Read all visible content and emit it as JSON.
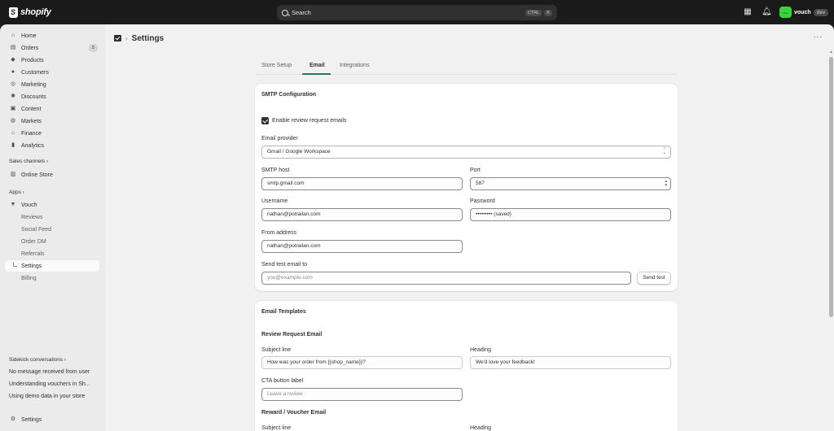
{
  "topbar": {
    "brand": "shopify",
    "search_placeholder": "Search",
    "search_shortcut": [
      "CTRL",
      "K"
    ],
    "account_name": "vouch",
    "account_badge": "dev",
    "avatar_initials": "vou"
  },
  "sidebar": {
    "nav": [
      {
        "label": "Home",
        "icon": "home-icon"
      },
      {
        "label": "Orders",
        "icon": "orders-icon",
        "count": "5"
      },
      {
        "label": "Products",
        "icon": "tag-icon"
      },
      {
        "label": "Customers",
        "icon": "person-icon"
      },
      {
        "label": "Marketing",
        "icon": "target-icon"
      },
      {
        "label": "Discounts",
        "icon": "discount-icon"
      },
      {
        "label": "Content",
        "icon": "content-icon"
      },
      {
        "label": "Markets",
        "icon": "globe-icon"
      },
      {
        "label": "Finance",
        "icon": "bank-icon"
      },
      {
        "label": "Analytics",
        "icon": "chart-icon"
      }
    ],
    "sales_channels_heading": "Sales channels",
    "online_store": "Online Store",
    "apps_heading": "Apps",
    "app_name": "Vouch",
    "app_subitems": [
      "Reviews",
      "Social Feed",
      "Order DM",
      "Referrals",
      "Settings",
      "Billing"
    ],
    "sidekick_heading": "Sidekick conversations",
    "sidekick_items": [
      "No message received from user",
      "Understanding vouchers in Sh...",
      "Using demo data in your store"
    ],
    "settings": "Settings"
  },
  "page": {
    "title": "Settings",
    "more": "···",
    "tabs": [
      "Store Setup",
      "Email",
      "Integrations"
    ],
    "active_tab": "Email"
  },
  "smtp": {
    "title": "SMTP Configuration",
    "enable_label": "Enable review request emails",
    "enable_checked": true,
    "provider_label": "Email provider",
    "provider_value": "Gmail / Google Workspace",
    "host_label": "SMTP host",
    "host_value": "smtp.gmail.com",
    "port_label": "Port",
    "port_value": "587",
    "username_label": "Username",
    "username_value": "nathan@potrailan.com",
    "password_label": "Password",
    "password_value": "••••••••• (saved)",
    "from_label": "From address",
    "from_value": "nathan@potrailan.com",
    "test_label": "Send test email to",
    "test_placeholder": "you@example.com",
    "send_test": "Send test"
  },
  "templates": {
    "title": "Email Templates",
    "review_heading": "Review Request Email",
    "subject_label": "Subject line",
    "subject_value": "How was your order from {{shop_name}}?",
    "heading_label": "Heading",
    "heading_value": "We'd love your feedback!",
    "cta_label": "CTA button label",
    "cta_placeholder": "Leave a review",
    "reward_heading": "Reward / Voucher Email",
    "reward_subject_label": "Subject line",
    "reward_heading_label": "Heading"
  }
}
